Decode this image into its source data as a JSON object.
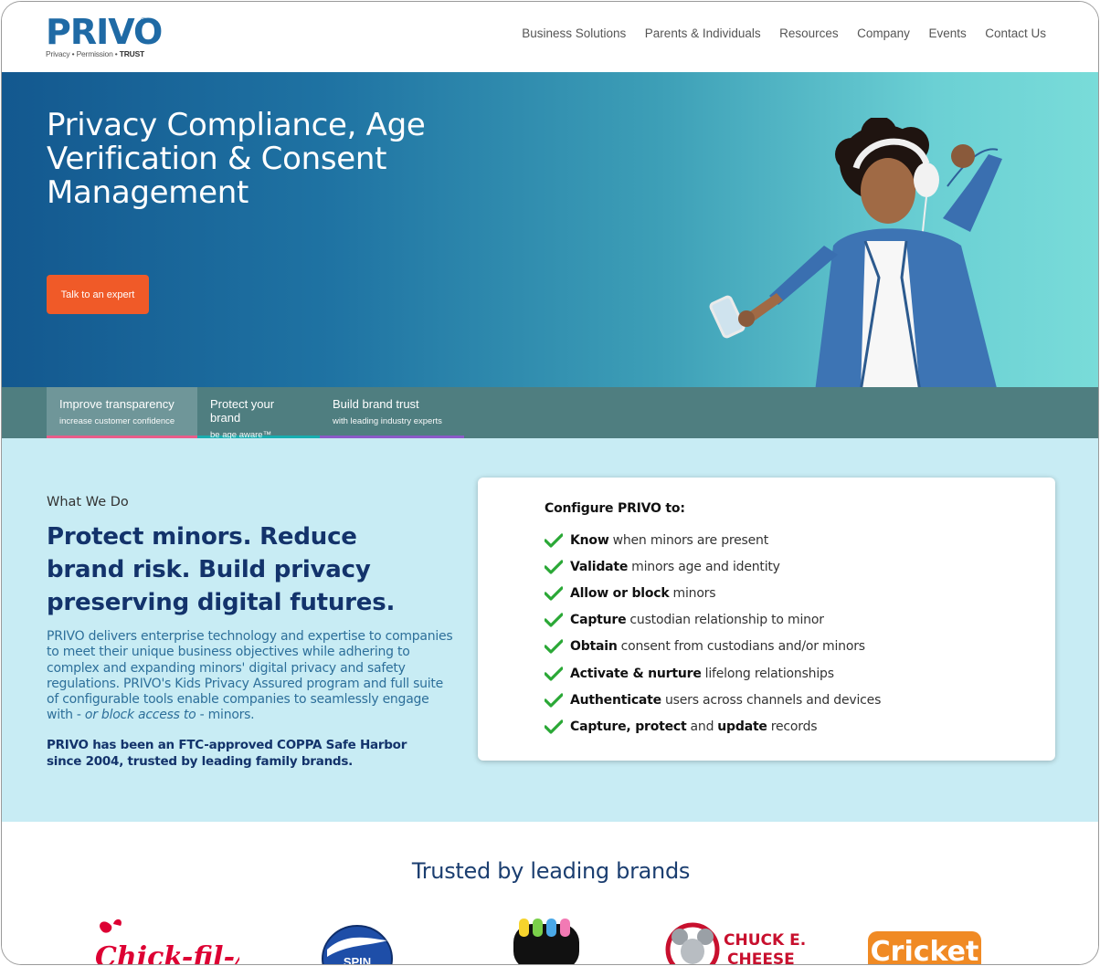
{
  "brand": {
    "logo_text": "PRIVO",
    "logo_registered": "®",
    "tagline_a": "Privacy • Permission • ",
    "tagline_b": "TRUST"
  },
  "nav": {
    "items": [
      "Business Solutions",
      "Parents & Individuals",
      "Resources",
      "Company",
      "Events",
      "Contact Us"
    ]
  },
  "hero": {
    "title": "Privacy Compliance, Age Verification & Consent Management",
    "cta_label": "Talk to an expert"
  },
  "tabs": [
    {
      "title": "Improve transparency",
      "subtitle": "increase customer confidence"
    },
    {
      "title": "Protect your brand",
      "subtitle": "be age aware™"
    },
    {
      "title": "Build brand trust",
      "subtitle": "with leading industry experts"
    }
  ],
  "what_we_do": {
    "kicker": "What We Do",
    "headline": "Protect minors. Reduce brand risk. Build privacy preserving digital futures.",
    "body_main": "PRIVO delivers enterprise technology and expertise to companies to meet their unique business objectives while adhering to complex and expanding minors' digital privacy and safety regulations. PRIVO's Kids Privacy Assured program and full suite of configurable tools enable companies to seamlessly engage with - ",
    "body_italic": "or block access to",
    "body_end": " - minors.",
    "footnote": "PRIVO has been an FTC-approved COPPA Safe Harbor since 2004, trusted by leading family brands."
  },
  "configure": {
    "title": "Configure PRIVO to:",
    "items": [
      {
        "bold": "Know",
        "rest": "when minors are present"
      },
      {
        "bold": "Validate",
        "rest": "minors age and identity"
      },
      {
        "bold": "Allow or block",
        "rest": "minors"
      },
      {
        "bold": "Capture",
        "rest": "custodian relationship to minor"
      },
      {
        "bold": "Obtain",
        "rest": "consent from custodians and/or minors"
      },
      {
        "bold": "Activate & nurture",
        "rest": "lifelong relationships"
      },
      {
        "bold": "Authenticate",
        "rest": "users across channels and devices"
      },
      {
        "bold": "Capture, protect",
        "rest": "and",
        "bold2": "update",
        "rest2": "records"
      }
    ]
  },
  "trusted": {
    "title": "Trusted by leading brands",
    "logos": {
      "chickfila": "Chick-fil-A",
      "spin": "SPIN",
      "chuck_a": "CHUCK E.",
      "chuck_b": "CHEESE",
      "cricket": "Cricket"
    }
  },
  "colors": {
    "brand_blue": "#1f6aa5",
    "navy": "#13336b",
    "cta_orange": "#f05a28",
    "check_green": "#2aa836",
    "section_bg": "#c8ecf4"
  }
}
